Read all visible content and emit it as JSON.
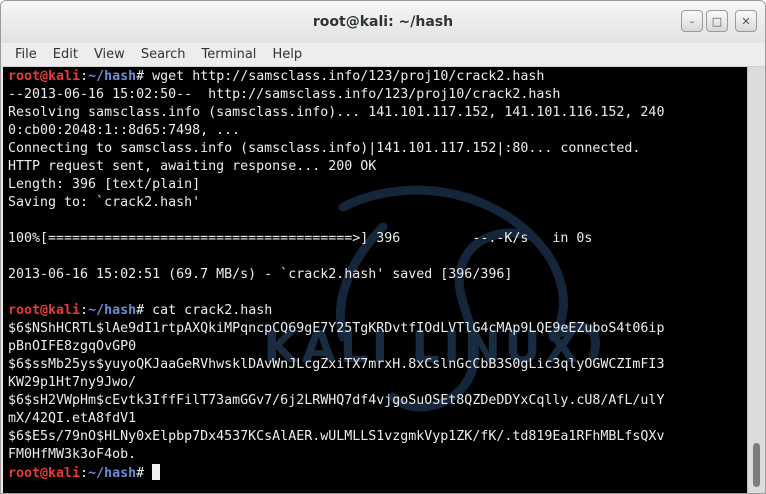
{
  "window": {
    "title": "root@kali: ~/hash",
    "minimize_glyph": "–",
    "maximize_glyph": "□",
    "close_glyph": "✕"
  },
  "menu": [
    "File",
    "Edit",
    "View",
    "Search",
    "Terminal",
    "Help"
  ],
  "prompt": {
    "user": "root",
    "at": "@",
    "host": "kali",
    "colon": ":",
    "path": "~/hash",
    "hash": "#"
  },
  "watermark_text": "KALI LINUX",
  "terminal_lines": [
    {
      "type": "prompt",
      "cmd": " wget http://samsclass.info/123/proj10/crack2.hash"
    },
    {
      "type": "text",
      "text": "--2013-06-16 15:02:50--  http://samsclass.info/123/proj10/crack2.hash"
    },
    {
      "type": "text",
      "text": "Resolving samsclass.info (samsclass.info)... 141.101.117.152, 141.101.116.152, 240"
    },
    {
      "type": "text",
      "text": "0:cb00:2048:1::8d65:7498, ..."
    },
    {
      "type": "text",
      "text": "Connecting to samsclass.info (samsclass.info)|141.101.117.152|:80... connected."
    },
    {
      "type": "text",
      "text": "HTTP request sent, awaiting response... 200 OK"
    },
    {
      "type": "text",
      "text": "Length: 396 [text/plain]"
    },
    {
      "type": "text",
      "text": "Saving to: `crack2.hash'"
    },
    {
      "type": "text",
      "text": ""
    },
    {
      "type": "text",
      "text": "100%[======================================>] 396         --.-K/s   in 0s"
    },
    {
      "type": "text",
      "text": ""
    },
    {
      "type": "text",
      "text": "2013-06-16 15:02:51 (69.7 MB/s) - `crack2.hash' saved [396/396]"
    },
    {
      "type": "text",
      "text": ""
    },
    {
      "type": "prompt",
      "cmd": " cat crack2.hash"
    },
    {
      "type": "text",
      "text": "$6$NShHCRTL$lAe9dI1rtpAXQkiMPqncpCQ69gE7Y25TgKRDvtfIOdLVTlG4cMAp9LQE9eEZuboS4t06ip"
    },
    {
      "type": "text",
      "text": "pBnOIFE8zgqOvGP0"
    },
    {
      "type": "text",
      "text": "$6$ssMb25ys$yuyoQKJaaGeRVhwsklDAvWnJLcgZxiTX7mrxH.8xCslnGcCbB3S0gLic3qlyOGWCZImFI3"
    },
    {
      "type": "text",
      "text": "KW29p1Ht7ny9Jwo/"
    },
    {
      "type": "text",
      "text": "$6$sH2VWpHm$cEvtk3IffFilT73amGGv7/6j2LRWHQ7df4vjgoSuOSEt8QZDeDDYxCqlly.cU8/AfL/ulY"
    },
    {
      "type": "text",
      "text": "mX/42QI.etA8fdV1"
    },
    {
      "type": "text",
      "text": "$6$E5s/79nO$HLNy0xElpbp7Dx4537KCsAlAER.wULMLLS1vzgmkVyp1ZK/fK/.td819Ea1RFhMBLfsQXv"
    },
    {
      "type": "text",
      "text": "FM0HfMW3k3oF4ob."
    },
    {
      "type": "prompt",
      "cmd": " ",
      "cursor": true
    }
  ],
  "colors": {
    "terminal_bg": "#000000",
    "terminal_fg": "#ededed",
    "prompt_user": "#e83a3a",
    "prompt_path": "#6a8fd9"
  }
}
